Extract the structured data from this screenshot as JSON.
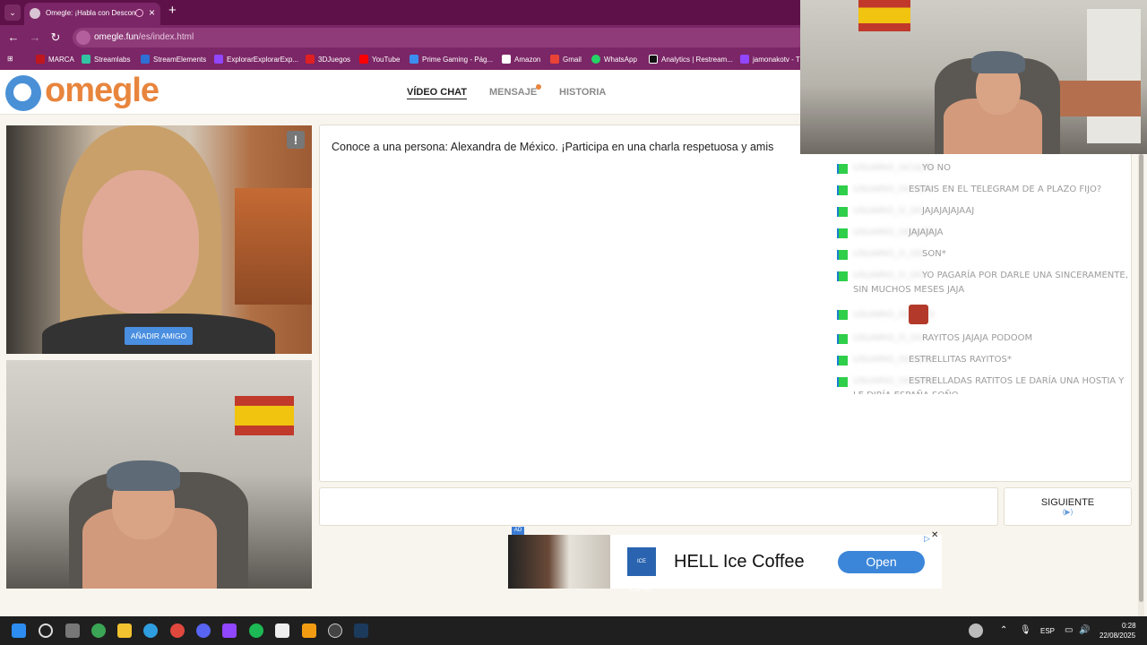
{
  "browser": {
    "tab_title": "Omegle: ¡Habla con Descon",
    "url_host": "omegle.fun",
    "url_path": "/es/index.html",
    "bookmarks": [
      "MARCA",
      "Streamlabs",
      "StreamElements",
      "ExplorarExplorarExp...",
      "3DJuegos",
      "YouTube",
      "Prime Gaming - Pág...",
      "Amazon",
      "Gmail",
      "WhatsApp",
      "Analytics | Restream...",
      "jamonakotv - T"
    ]
  },
  "site": {
    "logo_text": "omegle",
    "nav": [
      "VÍDEO CHAT",
      "MENSAJE",
      "HISTORIA"
    ]
  },
  "video": {
    "report_label": "!",
    "add_friend_label": "AÑADIR AMIGO"
  },
  "chat": {
    "intro": "Conoce a una persona: Alexandra de México. ¡Participa en una charla respetuosa y amis",
    "next_label": "SIGUIENTE",
    "next_hint": "(▶)"
  },
  "ad": {
    "badge": "AD",
    "title": "HELL Ice Coffee",
    "button": "Open",
    "close": "✕",
    "logo": "ICE COFFEE"
  },
  "stream_chat": [
    {
      "user": "usuario_oculto",
      "text": "YO NO"
    },
    {
      "user": "usuario_oculto",
      "text": "ESTAIS EN EL TELEGRAM DE A PLAZO FIJO?"
    },
    {
      "user": "usuario_o_oo",
      "text": "JAJAJAJAJAAJ"
    },
    {
      "user": "usuario_oculto",
      "text": "JAJAJAJA"
    },
    {
      "user": "usuario_o_oo",
      "text": "SON*"
    },
    {
      "user": "usuario_o_oo",
      "text": "YO PAGARÍA POR DARLE UNA SINCERAMENTE, SIN MUCHOS MESES JAJA"
    },
    {
      "user": "usuario_oculto",
      "text": ""
    },
    {
      "user": "usuario_o_oo",
      "text": "RAYITOS JAJAJA PODOOM"
    },
    {
      "user": "usuario_oculto",
      "text": "ESTRELLITAS RAYITOS*"
    },
    {
      "user": "usuario_oculto",
      "text": "ESTRELLADAS RATITOS LE DARÍA UNA HOSTIA Y LE DIRÍA ESPAÑA SOÑO"
    }
  ],
  "taskbar": {
    "language": "ESP",
    "time": "0:28",
    "date": "22/08/2025"
  },
  "colors": {
    "tab_bar": "#5e1149",
    "toolbar": "#7b2666",
    "logo_orange": "#e8853d",
    "logo_blue": "#4a90d6",
    "button_blue": "#4a8fe0"
  }
}
